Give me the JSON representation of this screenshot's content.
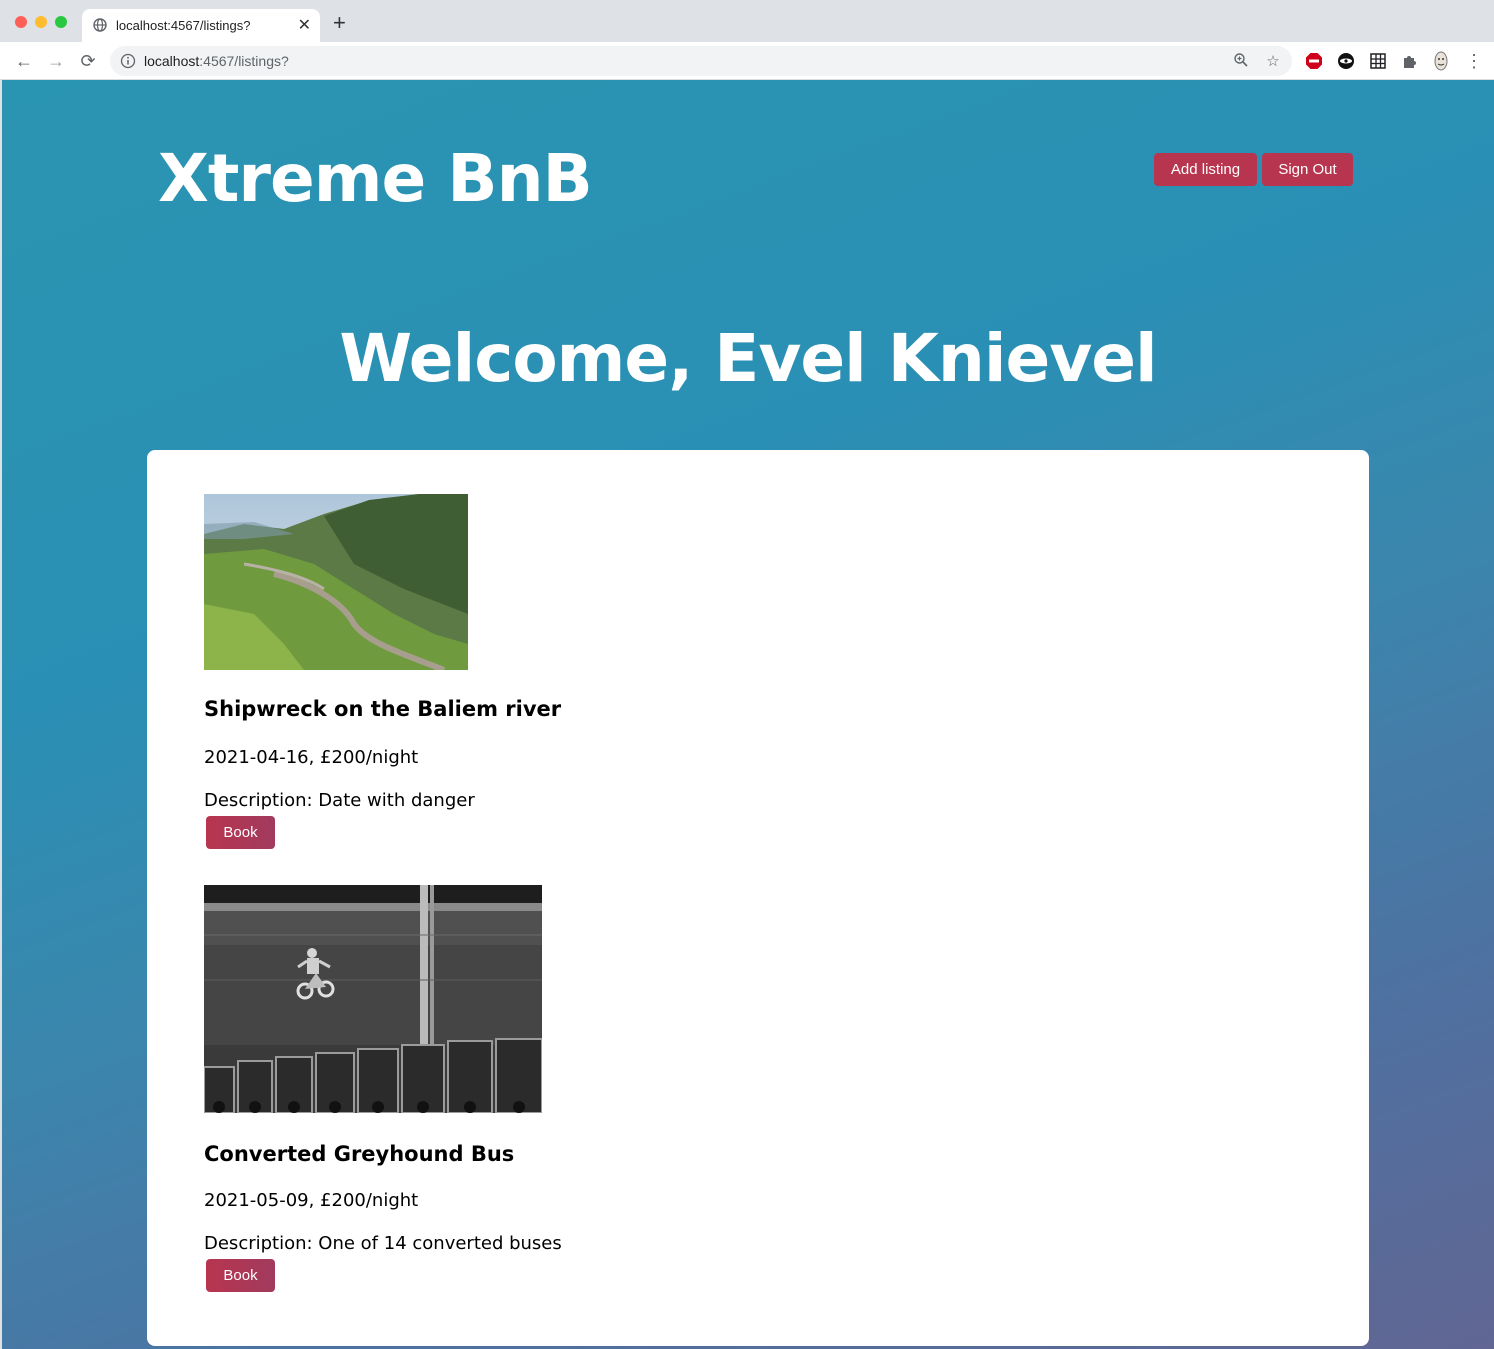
{
  "browser": {
    "tab_title": "localhost:4567/listings?",
    "new_tab_label": "+",
    "url_host": "localhost",
    "url_path": ":4567/listings?"
  },
  "header": {
    "logo": "Xtreme BnB",
    "add_listing_label": "Add listing",
    "sign_out_label": "Sign Out"
  },
  "welcome": "Welcome, Evel Knievel",
  "listings": [
    {
      "title": "Shipwreck on the Baliem river",
      "meta": "2021-04-16, £200/night",
      "description": "Description: Date with danger",
      "book_label": "Book",
      "image": "river-valley-photo"
    },
    {
      "title": "Converted Greyhound Bus",
      "meta": "2021-05-09, £200/night",
      "description": "Description: One of 14 converted buses",
      "book_label": "Book",
      "image": "motorcycle-jump-photo"
    }
  ]
}
